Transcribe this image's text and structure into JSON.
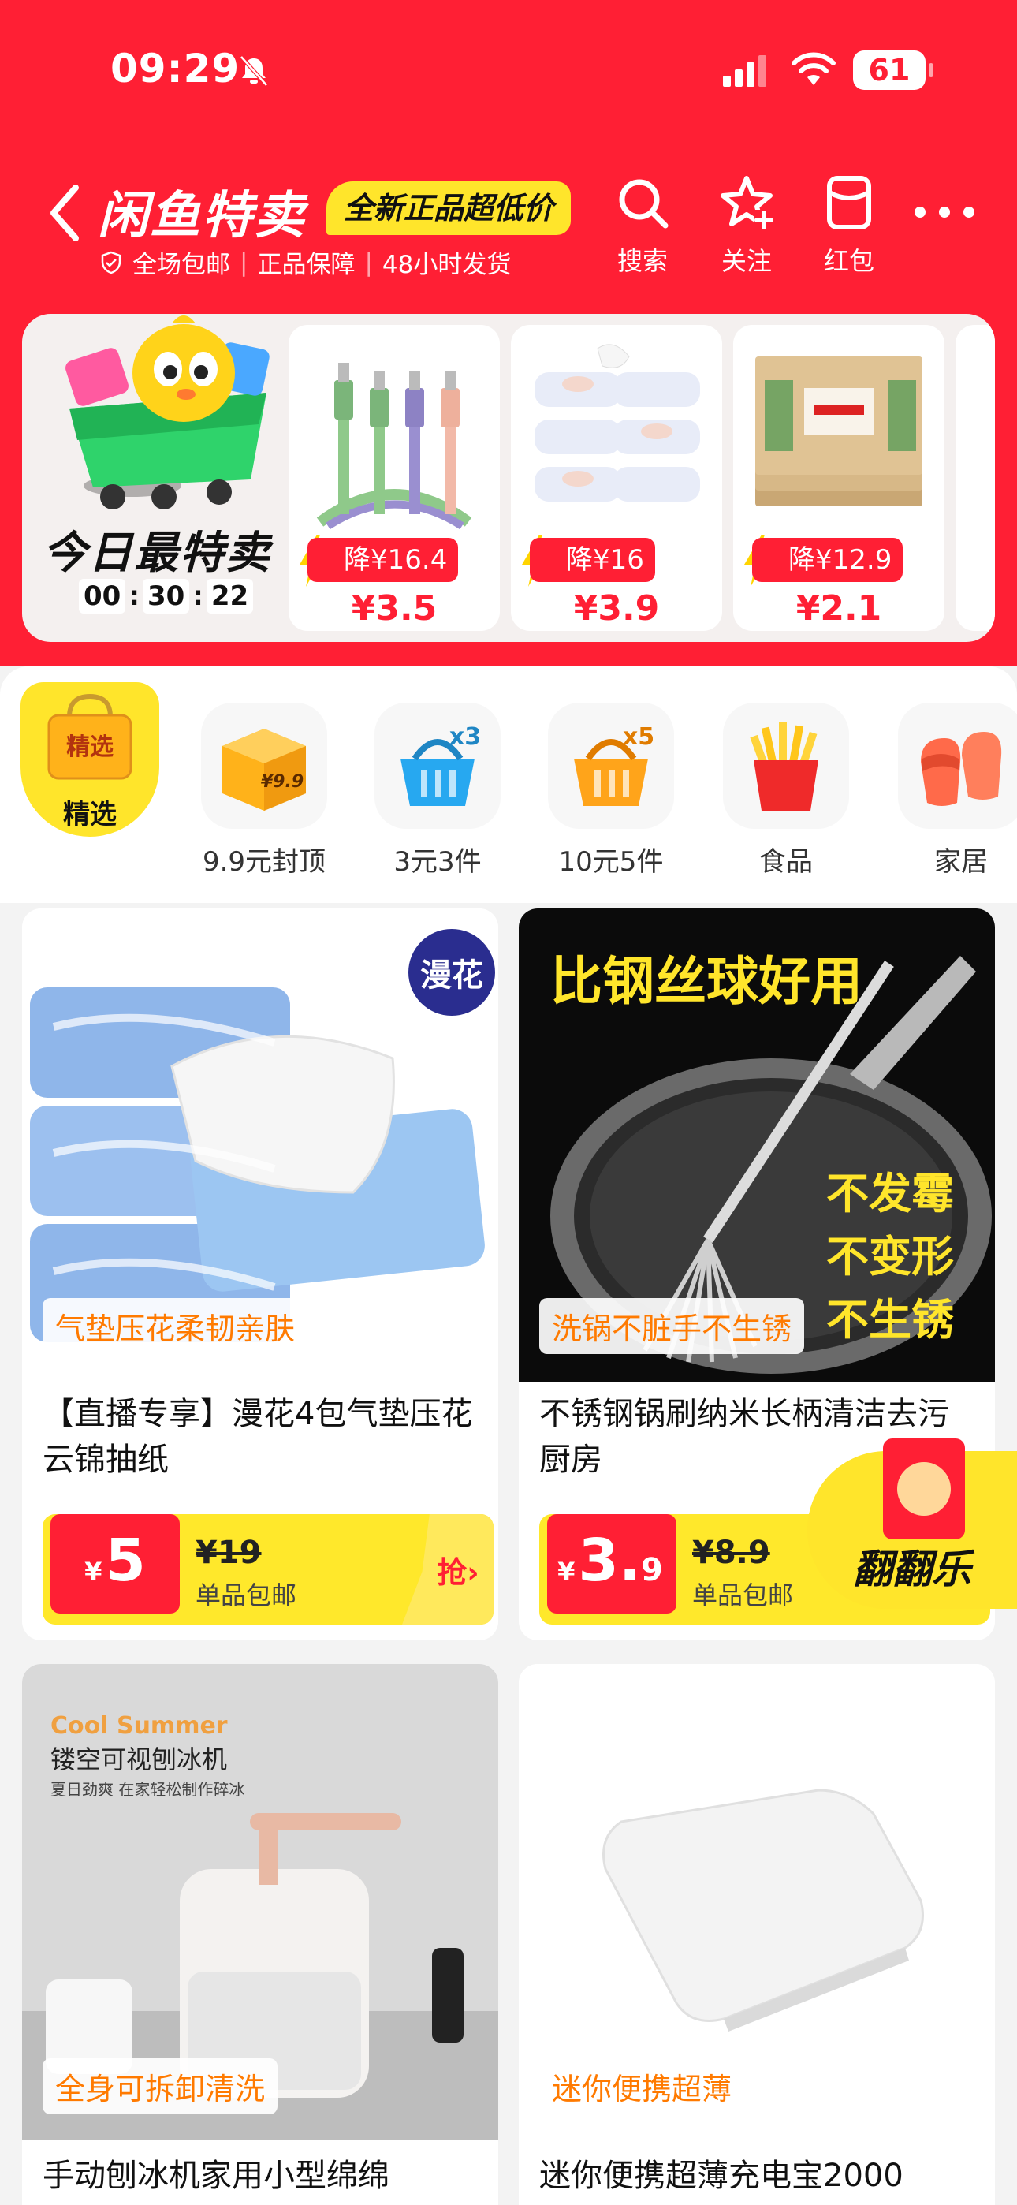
{
  "status_bar": {
    "time": "09:29",
    "battery": "61"
  },
  "header": {
    "brand": "闲鱼特卖",
    "slogan": "全新正品超低价",
    "promises": [
      "全场包邮",
      "正品保障",
      "48小时发货"
    ],
    "tools": [
      {
        "label": "搜索",
        "icon": "search-icon"
      },
      {
        "label": "关注",
        "icon": "star-plus-icon"
      },
      {
        "label": "红包",
        "icon": "red-packet-icon"
      }
    ]
  },
  "deals": {
    "title": "今日最特卖",
    "countdown": [
      "00",
      "30",
      "22"
    ],
    "countdown_sep": ":",
    "items": [
      {
        "drop": "降¥16.4",
        "price": "¥3.5",
        "image": "charging-cables"
      },
      {
        "drop": "降¥16",
        "price": "¥3.9",
        "image": "wet-wipes"
      },
      {
        "drop": "降¥12.9",
        "price": "¥2.1",
        "image": "toothpicks"
      }
    ]
  },
  "categories": {
    "featured": {
      "label": "精选",
      "bag_text": "精选"
    },
    "items": [
      {
        "label": "9.9元封顶",
        "icon": "box-icon",
        "icon_text": "¥9.9"
      },
      {
        "label": "3元3件",
        "icon": "basket-blue-icon",
        "icon_text": "x3"
      },
      {
        "label": "10元5件",
        "icon": "basket-orange-icon",
        "icon_text": "x5"
      },
      {
        "label": "食品",
        "icon": "fries-icon"
      },
      {
        "label": "家居",
        "icon": "slippers-icon"
      }
    ]
  },
  "products": [
    {
      "badge": "漫花",
      "tagline": "气垫压花柔韧亲肤",
      "title": "【直播专享】漫花4包气垫压花云锦抽纸",
      "currency": "¥",
      "price": "5",
      "price_decimal": "",
      "original": "¥19",
      "shipping": "单品包邮",
      "cta": "抢›"
    },
    {
      "image_headline": "比钢丝球好用",
      "image_claims": [
        "不发霉",
        "不变形",
        "不生锈"
      ],
      "tagline": "洗锅不脏手不生锈",
      "title": "不锈钢锅刷纳米长柄清洁去污厨房",
      "currency": "¥",
      "price": "3.",
      "price_decimal": "9",
      "original": "¥8.9",
      "shipping": "单品包邮"
    },
    {
      "image_kicker": "Cool Summer",
      "image_headline": "镂空可视刨冰机",
      "image_sub": "夏日劲爽 在家轻松制作碎冰",
      "tagline": "全身可拆卸清洗",
      "title": "手动刨冰机家用小型绵绵"
    },
    {
      "tagline": "迷你便携超薄",
      "title": "迷你便携超薄充电宝2000"
    }
  ],
  "floating": {
    "label": "翻翻乐"
  },
  "colors": {
    "brand_red": "#ff1f34",
    "yellow": "#ffe52b",
    "tag_orange": "#ff7a00"
  }
}
